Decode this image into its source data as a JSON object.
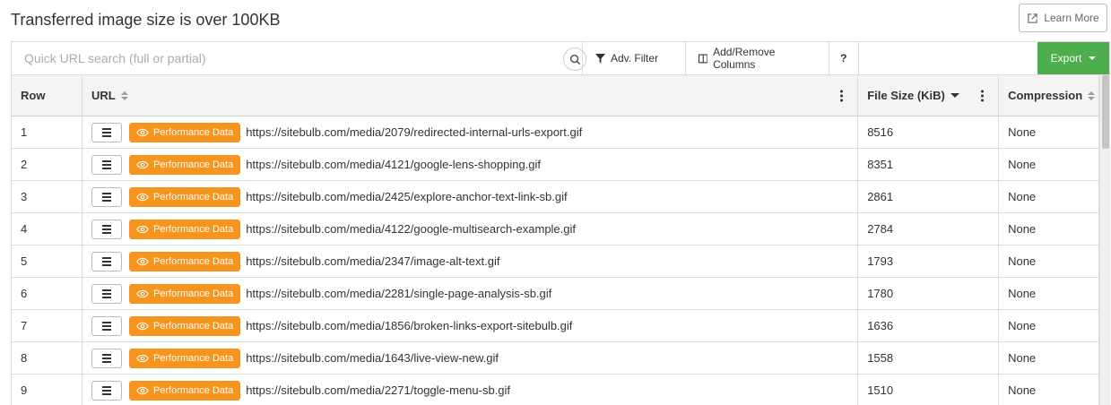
{
  "page": {
    "title": "Transferred image size is over 100KB",
    "learn_more": "Learn More"
  },
  "toolbar": {
    "search_placeholder": "Quick URL search (full or partial)",
    "adv_filter": "Adv. Filter",
    "add_remove_columns": "Add/Remove Columns",
    "help": "?",
    "export": "Export"
  },
  "columns": {
    "row": "Row",
    "url": "URL",
    "file_size": "File Size (KiB)",
    "compression": "Compression"
  },
  "perf_label": "Performance Data",
  "rows": [
    {
      "row": "1",
      "url": "https://sitebulb.com/media/2079/redirected-internal-urls-export.gif",
      "size": "8516",
      "compression": "None"
    },
    {
      "row": "2",
      "url": "https://sitebulb.com/media/4121/google-lens-shopping.gif",
      "size": "8351",
      "compression": "None"
    },
    {
      "row": "3",
      "url": "https://sitebulb.com/media/2425/explore-anchor-text-link-sb.gif",
      "size": "2861",
      "compression": "None"
    },
    {
      "row": "4",
      "url": "https://sitebulb.com/media/4122/google-multisearch-example.gif",
      "size": "2784",
      "compression": "None"
    },
    {
      "row": "5",
      "url": "https://sitebulb.com/media/2347/image-alt-text.gif",
      "size": "1793",
      "compression": "None"
    },
    {
      "row": "6",
      "url": "https://sitebulb.com/media/2281/single-page-analysis-sb.gif",
      "size": "1780",
      "compression": "None"
    },
    {
      "row": "7",
      "url": "https://sitebulb.com/media/1856/broken-links-export-sitebulb.gif",
      "size": "1636",
      "compression": "None"
    },
    {
      "row": "8",
      "url": "https://sitebulb.com/media/1643/live-view-new.gif",
      "size": "1558",
      "compression": "None"
    },
    {
      "row": "9",
      "url": "https://sitebulb.com/media/2271/toggle-menu-sb.gif",
      "size": "1510",
      "compression": "None"
    }
  ],
  "colors": {
    "accent_orange": "#f7941d",
    "export_green": "#4cae4c"
  }
}
